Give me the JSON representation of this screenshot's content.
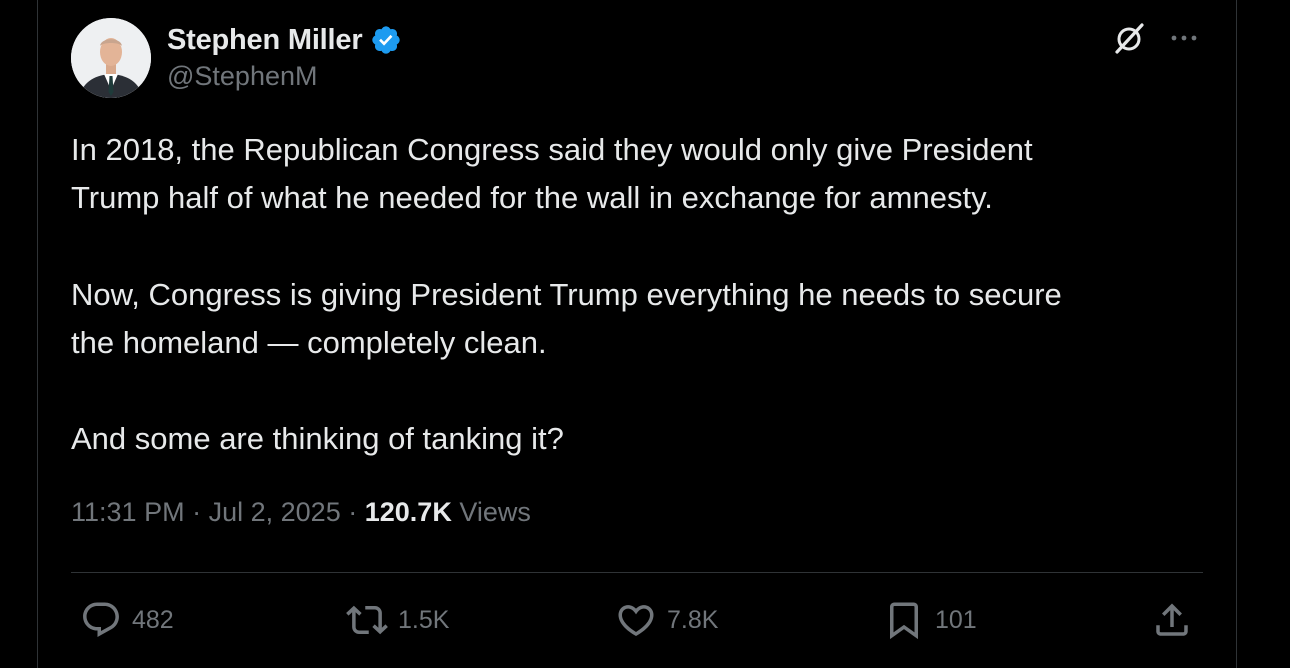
{
  "author": {
    "name": "Stephen Miller",
    "handle": "@StephenM",
    "verified": true,
    "verified_color": "#1d9bf0"
  },
  "icons": {
    "grok": "grok-icon",
    "more": "more-icon",
    "reply": "reply-icon",
    "repost": "repost-icon",
    "like": "like-icon",
    "bookmark": "bookmark-icon",
    "share": "share-icon"
  },
  "tweet": {
    "paragraphs": [
      [
        "In 2018, the Republican Congress said they would only give President",
        "Trump half of what he needed for the wall in exchange for amnesty."
      ],
      [
        "Now, Congress is giving President Trump everything he needs to secure",
        "the homeland — completely clean."
      ],
      [
        "And some are thinking of tanking it?"
      ]
    ]
  },
  "meta": {
    "time": "11:31 PM",
    "separator": "·",
    "date": "Jul 2, 2025",
    "views_count": "120.7K",
    "views_label": "Views"
  },
  "actions": {
    "replies": "482",
    "reposts": "1.5K",
    "likes": "7.8K",
    "bookmarks": "101"
  },
  "colors": {
    "background": "#000000",
    "text_primary": "#e7e9ea",
    "text_secondary": "#71767b",
    "border": "#2f3336",
    "accent": "#1d9bf0"
  }
}
